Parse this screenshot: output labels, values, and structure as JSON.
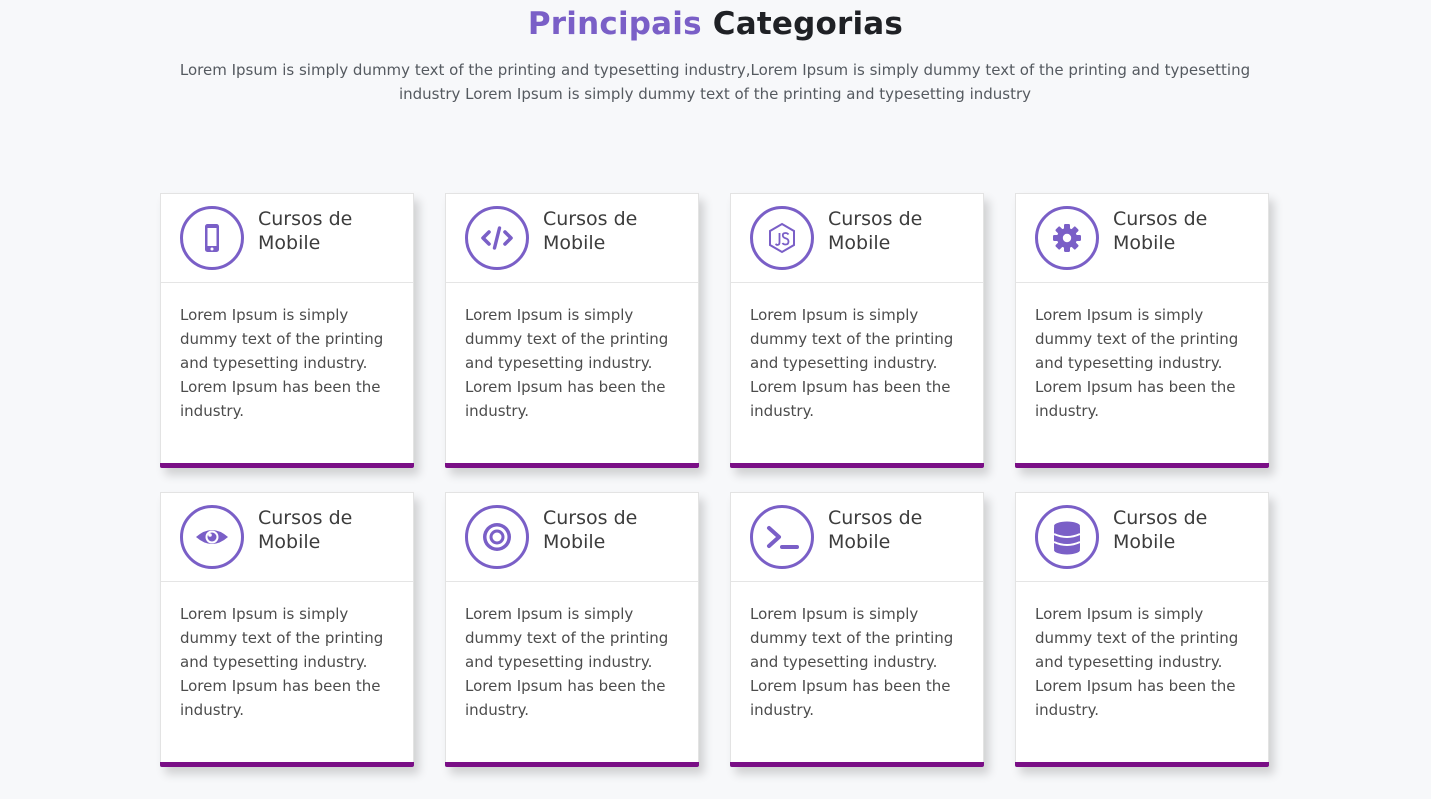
{
  "header": {
    "title_accent": "Principais",
    "title_rest": "Categorias",
    "subtitle": "Lorem Ipsum is simply dummy text of the printing and typesetting industry,Lorem Ipsum is simply dummy text of the printing and typesetting industry Lorem Ipsum is simply dummy text of the printing and typesetting industry"
  },
  "colors": {
    "accent": "#7a5fc7",
    "card_bottom_bar": "#7a0f86",
    "background": "#f7f8fa"
  },
  "cards": [
    {
      "icon": "mobile-phone-icon",
      "title": "Cursos de Mobile",
      "body": "Lorem Ipsum is simply dummy text of the printing and typesetting industry. Lorem Ipsum has been the industry."
    },
    {
      "icon": "code-icon",
      "title": "Cursos de Mobile",
      "body": "Lorem Ipsum is simply dummy text of the printing and typesetting industry. Lorem Ipsum has been the industry."
    },
    {
      "icon": "nodejs-icon",
      "title": "Cursos de Mobile",
      "body": "Lorem Ipsum is simply dummy text of the printing and typesetting industry. Lorem Ipsum has been the industry."
    },
    {
      "icon": "gear-icon",
      "title": "Cursos de Mobile",
      "body": "Lorem Ipsum is simply dummy text of the printing and typesetting industry. Lorem Ipsum has been the industry."
    },
    {
      "icon": "eye-icon",
      "title": "Cursos de Mobile",
      "body": "Lorem Ipsum is simply dummy text of the printing and typesetting industry. Lorem Ipsum has been the industry."
    },
    {
      "icon": "target-icon",
      "title": "Cursos de Mobile",
      "body": "Lorem Ipsum is simply dummy text of the printing and typesetting industry. Lorem Ipsum has been the industry."
    },
    {
      "icon": "terminal-icon",
      "title": "Cursos de Mobile",
      "body": "Lorem Ipsum is simply dummy text of the printing and typesetting industry. Lorem Ipsum has been the industry."
    },
    {
      "icon": "database-icon",
      "title": "Cursos de Mobile",
      "body": "Lorem Ipsum is simply dummy text of the printing and typesetting industry. Lorem Ipsum has been the industry."
    }
  ]
}
